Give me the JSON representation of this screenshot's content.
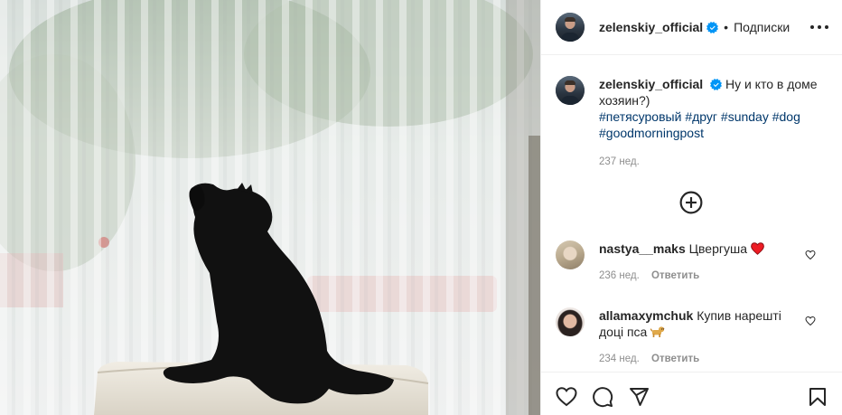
{
  "post": {
    "username": "zelenskiy_official",
    "separator": "•",
    "follow_label": "Подписки",
    "caption_text": "Ну и кто в доме хозяин?)",
    "hashtags": [
      "#петясуровый",
      "#друг",
      "#sunday",
      "#dog",
      "#goodmorningpost"
    ],
    "time": "237 нед."
  },
  "comments": [
    {
      "username": "nastya__maks",
      "text": "Цвергуша",
      "emoji": "❤️",
      "time": "236 нед.",
      "reply_label": "Ответить"
    },
    {
      "username": "allamaxymchuk",
      "text": "Купив нарешті доці пса",
      "emoji": "🐕",
      "time": "234 нед.",
      "reply_label": "Ответить"
    }
  ],
  "icons": {
    "verified": "verified-badge-icon",
    "more": "more-options-icon",
    "add_comments": "plus-circle-icon",
    "like": "heart-icon",
    "comment": "comment-icon",
    "share": "send-icon",
    "save": "bookmark-icon"
  },
  "colors": {
    "verified": "#0095f6",
    "hashtag": "#00376b",
    "muted": "#8e8e8e",
    "heart_red": "#ed1c24"
  }
}
